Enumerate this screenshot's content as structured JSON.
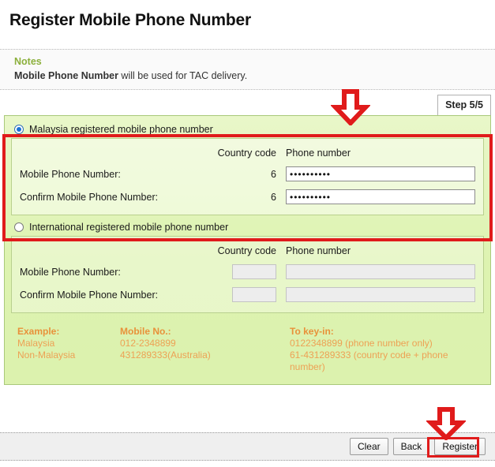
{
  "page": {
    "title": "Register Mobile Phone Number"
  },
  "notes": {
    "heading": "Notes",
    "text_bold": "Mobile Phone Number",
    "text_rest": " will be used for TAC delivery."
  },
  "step": {
    "badge": "Step 5/5"
  },
  "columns": {
    "country_code": "Country code",
    "phone_number": "Phone number"
  },
  "malaysia_section": {
    "radio_label": "Malaysia registered mobile phone number",
    "selected": true,
    "rows": [
      {
        "label": "Mobile Phone Number:",
        "country_code": "6",
        "phone_value": "••••••••••",
        "phone_placeholder": ""
      },
      {
        "label": "Confirm Mobile Phone Number:",
        "country_code": "6",
        "phone_value": "••••••••••",
        "phone_placeholder": ""
      }
    ]
  },
  "international_section": {
    "radio_label": "International registered mobile phone number",
    "selected": false,
    "rows": [
      {
        "label": "Mobile Phone Number:",
        "country_code": "",
        "phone_value": "",
        "phone_placeholder": ""
      },
      {
        "label": "Confirm Mobile Phone Number:",
        "country_code": "",
        "phone_value": "",
        "phone_placeholder": ""
      }
    ]
  },
  "example": {
    "col1_head": "Example:",
    "col1_line1": "Malaysia",
    "col1_line2": "Non-Malaysia",
    "col2_head": "Mobile No.:",
    "col2_line1": "012-2348899",
    "col2_line2": "431289333(Australia)",
    "col3_head": "To key-in:",
    "col3_line1": "0122348899 (phone number only)",
    "col3_line2": "61-431289333 (country code + phone number)"
  },
  "footer": {
    "clear_label": "Clear",
    "back_label": "Back",
    "register_label": "Register"
  },
  "annotations": {
    "color": "#e01b1b",
    "arrow_top_name": "down-arrow-icon",
    "arrow_bottom_name": "down-arrow-icon"
  },
  "colors": {
    "notes_heading": "#8cb03c",
    "example_text": "#e8913a",
    "panel_green": "#ddf3b0",
    "annotation_red": "#e01b1b",
    "radio_selected": "#1a72d6"
  }
}
